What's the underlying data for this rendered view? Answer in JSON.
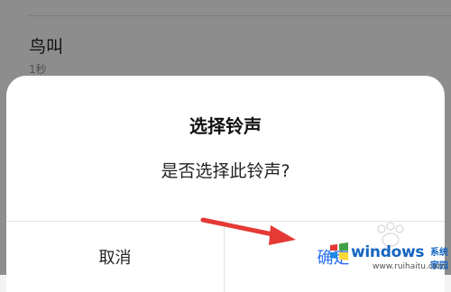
{
  "background": {
    "item_title": "鸟叫",
    "item_duration": "1秒"
  },
  "dialog": {
    "title": "选择铃声",
    "message": "是否选择此铃声?",
    "cancel_label": "取消",
    "confirm_label": "确定"
  },
  "watermark": {
    "title": "windows",
    "subtitle": "系统家园",
    "url": "www.ruihaitu.com"
  },
  "colors": {
    "accent": "#2b6ef0",
    "arrow": "#e53935",
    "watermark": "#1565c0"
  }
}
